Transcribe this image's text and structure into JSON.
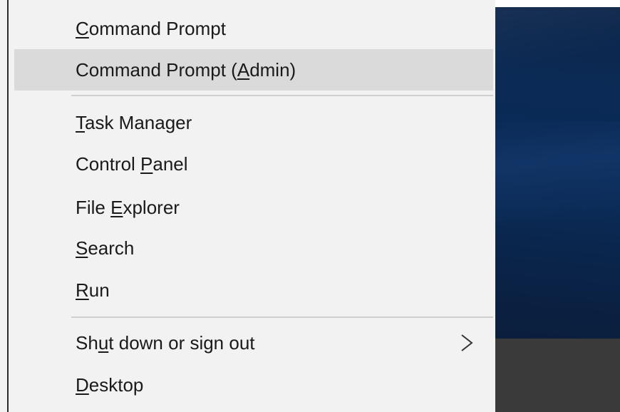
{
  "menu": {
    "items": [
      {
        "id": "command-prompt",
        "pre": "",
        "acc": "C",
        "post": "ommand Prompt",
        "highlighted": false
      },
      {
        "id": "command-prompt-admin",
        "pre": "Command Prompt (",
        "acc": "A",
        "post": "dmin)",
        "highlighted": true
      },
      {
        "id": "task-manager",
        "pre": "",
        "acc": "T",
        "post": "ask Manager",
        "highlighted": false
      },
      {
        "id": "control-panel",
        "pre": "Control ",
        "acc": "P",
        "post": "anel",
        "highlighted": false
      },
      {
        "id": "file-explorer",
        "pre": "File ",
        "acc": "E",
        "post": "xplorer",
        "highlighted": false
      },
      {
        "id": "search",
        "pre": "",
        "acc": "S",
        "post": "earch",
        "highlighted": false
      },
      {
        "id": "run",
        "pre": "",
        "acc": "R",
        "post": "un",
        "highlighted": false
      },
      {
        "id": "shut-down",
        "pre": "Sh",
        "acc": "u",
        "post": "t down or sign out",
        "highlighted": false,
        "submenu": true
      },
      {
        "id": "desktop",
        "pre": "",
        "acc": "D",
        "post": "esktop",
        "highlighted": false
      }
    ]
  },
  "icons": {
    "submenu_arrow": "chevron-right-icon"
  },
  "colors": {
    "menu_background": "#f2f2f2",
    "highlight": "#dadada",
    "separator": "#cfcfcf",
    "text": "#1a1a1a",
    "desktop_blue": "#0a2b58",
    "taskbar": "#3a3a3a"
  }
}
